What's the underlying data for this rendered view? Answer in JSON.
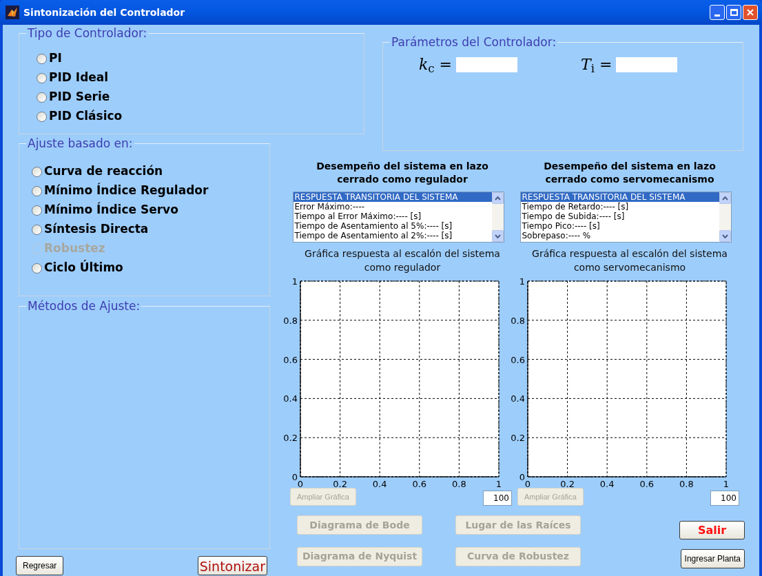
{
  "window": {
    "title": "Sintonización del Controlador"
  },
  "controller_type": {
    "title": "Tipo de Controlador:",
    "options": [
      {
        "label": "PI",
        "selected": false
      },
      {
        "label": "PID Ideal",
        "selected": false
      },
      {
        "label": "PID Serie",
        "selected": false
      },
      {
        "label": "PID Clásico",
        "selected": false
      }
    ]
  },
  "parameters": {
    "title": "Parámetros del Controlador:",
    "fields": [
      {
        "label": "*k*$_{c}$ ="
      },
      {
        "label": "*T*$_{i}$ ="
      }
    ]
  },
  "tuning_basis": {
    "title": "Ajuste basado en:",
    "options": [
      {
        "label": "Curva de reacción",
        "selected": false,
        "disabled": false
      },
      {
        "label": "Mínimo Índice Regulador",
        "selected": false,
        "disabled": false
      },
      {
        "label": "Mínimo Índice Servo",
        "selected": false,
        "disabled": false
      },
      {
        "label": "Síntesis Directa",
        "selected": false,
        "disabled": false
      },
      {
        "label": "Robustez",
        "selected": false,
        "disabled": true
      },
      {
        "label": "Ciclo Último",
        "selected": false,
        "disabled": false
      }
    ]
  },
  "methods": {
    "title": "Métodos de Ajuste:"
  },
  "panels": [
    {
      "heading": "Desempeño del sistema en lazo cerrado como regulador",
      "list": [
        {
          "text": "RESPUESTA TRANSITORIA DEL SISTEMA",
          "selected": true
        },
        {
          "text": "Error Máximo:----",
          "selected": false
        },
        {
          "text": "Tiempo al Error Máximo:---- [s]",
          "selected": false
        },
        {
          "text": "Tiempo de Asentamiento al 5%:---- [s]",
          "selected": false
        },
        {
          "text": "Tiempo de Asentamiento al 2%:---- [s]",
          "selected": false
        }
      ],
      "chart_caption": "Gráfica respuesta al escalón del sistema como regulador",
      "chart_data": {
        "type": "line",
        "grid": true,
        "xlim": [
          0,
          1
        ],
        "ylim": [
          0,
          1
        ],
        "xticks": [
          0,
          0.2,
          0.4,
          0.6,
          0.8,
          1
        ],
        "yticks": [
          0,
          0.2,
          0.4,
          0.6,
          0.8,
          1
        ]
      },
      "zoom_button": {
        "label": "Ampliar Gráfica",
        "disabled": true
      },
      "value": "100"
    },
    {
      "heading": "Desempeño del sistema en lazo cerrado como servomecanismo",
      "list": [
        {
          "text": "RESPUESTA TRANSITORIA DEL SISTEMA",
          "selected": true
        },
        {
          "text": "Tiempo de Retardo:---- [s]",
          "selected": false
        },
        {
          "text": "Tiempo de Subida:---- [s]",
          "selected": false
        },
        {
          "text": "Tiempo Pico:---- [s]",
          "selected": false
        },
        {
          "text": "Sobrepaso:---- %",
          "selected": false
        }
      ],
      "chart_caption": "Gráfica respuesta al escalón del sistema como servomecanismo",
      "chart_data": {
        "type": "line",
        "grid": true,
        "xlim": [
          0,
          1
        ],
        "ylim": [
          0,
          1
        ],
        "xticks": [
          0,
          0.2,
          0.4,
          0.6,
          0.8,
          1
        ],
        "yticks": [
          0,
          0.2,
          0.4,
          0.6,
          0.8,
          1
        ]
      },
      "zoom_button": {
        "label": "Ampliar Gráfica",
        "disabled": true
      },
      "value": "100"
    }
  ],
  "analysis_buttons": [
    {
      "label": "Diagrama de Bode",
      "disabled": true
    },
    {
      "label": "Lugar de las Raíces",
      "disabled": true
    },
    {
      "label": "Diagrama de Nyquist",
      "disabled": true
    },
    {
      "label": "Curva de Robustez",
      "disabled": true
    }
  ],
  "back_button": {
    "label": "Regresar",
    "kind": "plain"
  },
  "tune_button": {
    "label": "Sintonizar",
    "kind": "accent"
  },
  "exit_button": {
    "label": "Salir",
    "kind": "danger"
  },
  "plant_button": {
    "label": "Ingresar Planta",
    "kind": "plain"
  }
}
